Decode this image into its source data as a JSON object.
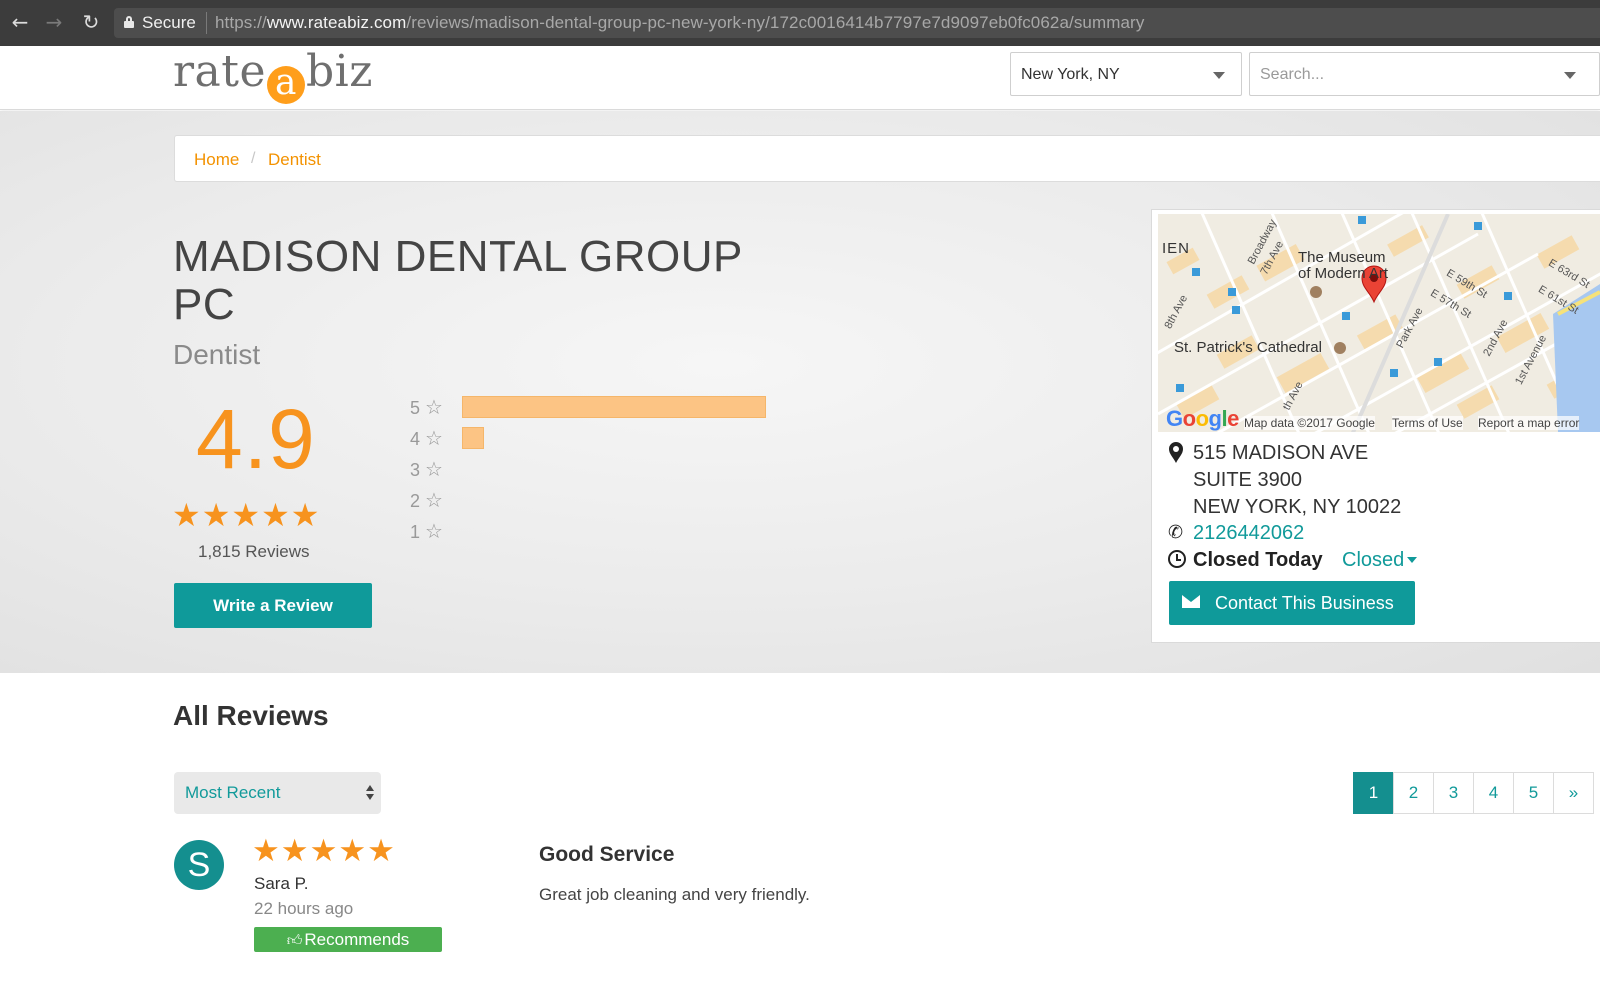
{
  "browser": {
    "secure_label": "Secure",
    "url_scheme": "https://",
    "url_host": "www.rateabiz.com",
    "url_path": "/reviews/madison-dental-group-pc-new-york-ny/172c0016414b7797e7d9097eb0fc062a/summary"
  },
  "header": {
    "logo_pre": "rate",
    "logo_a": "a",
    "logo_post": "biz",
    "location_value": "New York, NY",
    "search_placeholder": "Search..."
  },
  "breadcrumb": {
    "home": "Home",
    "separator": "/",
    "category": "Dentist"
  },
  "business": {
    "name": "MADISON DENTAL GROUP PC",
    "category": "Dentist",
    "rating": "4.9",
    "stars": "★★★★★",
    "review_count": "1,815 Reviews",
    "write_review_label": "Write a Review",
    "distribution": [
      {
        "stars": "5",
        "fraction": 0.95
      },
      {
        "stars": "4",
        "fraction": 0.07
      },
      {
        "stars": "3",
        "fraction": 0.0
      },
      {
        "stars": "2",
        "fraction": 0.0
      },
      {
        "stars": "1",
        "fraction": 0.0
      }
    ],
    "star_glyph": "☆"
  },
  "map": {
    "label_museum_1": "The Museum",
    "label_museum_2": "of Modern Art",
    "label_cathedral": "St. Patrick's Cathedral",
    "label_hen": "IEN",
    "streets": [
      "Broadway",
      "7th Ave",
      "8th Ave",
      "E 59th St",
      "E 57th St",
      "E 63rd St",
      "E 61st St",
      "Park Ave",
      "2nd Ave",
      "1st Avenue",
      "th Ave"
    ],
    "google": "Google",
    "map_data": "Map data ©2017 Google",
    "terms": "Terms of Use",
    "report": "Report a map error"
  },
  "contact": {
    "address_line1": "515 MADISON AVE",
    "address_line2": "SUITE 3900",
    "address_line3": "NEW YORK, NY 10022",
    "phone": "2126442062",
    "hours_status": "Closed Today",
    "hours_dropdown": "Closed",
    "contact_button": "Contact This Business"
  },
  "reviews": {
    "title": "All Reviews",
    "sort_value": "Most Recent",
    "pages": [
      "1",
      "2",
      "3",
      "4",
      "5",
      "»"
    ],
    "active_page": "1",
    "items": [
      {
        "avatar_letter": "S",
        "stars": "★★★★★",
        "author": "Sara P.",
        "time": "22 hours ago",
        "badge": "Recommends",
        "title": "Good Service",
        "body": "Great job cleaning and very friendly."
      }
    ]
  },
  "colors": {
    "accent_orange": "#f7931e",
    "teal": "#119a9a",
    "bar_fill": "#fcc484",
    "recommend_green": "#4caf50"
  }
}
